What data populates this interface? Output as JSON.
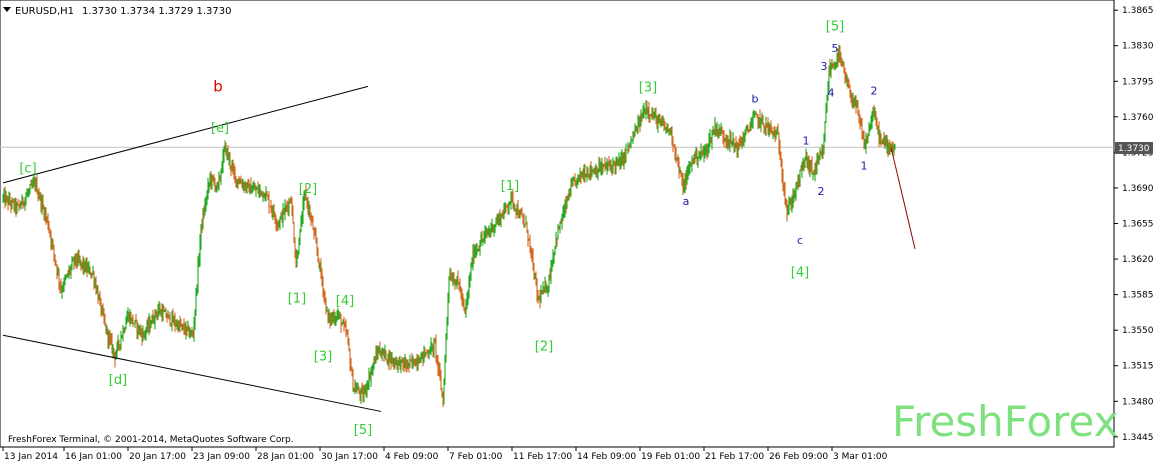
{
  "header": {
    "symbol": "EURUSD,H1",
    "ohlc": "1.3730 1.3734 1.3729 1.3730"
  },
  "current_price": "1.3730",
  "copyright": "FreshForex Terminal, © 2001-2014, MetaQuotes Software Corp.",
  "brand": "FreshForex",
  "colors": {
    "bull": "#22aa22",
    "bear": "#d2691e",
    "wave_green": "#33cc33",
    "wave_blue": "#1a1aa6",
    "wave_red": "#e00000",
    "forecast": "#8b0000",
    "brand": "#7fe07f"
  },
  "chart_data": {
    "type": "line",
    "ylim": [
      1.3435,
      1.3875
    ],
    "y_ticks": [
      "1.3865",
      "1.3830",
      "1.3795",
      "1.3760",
      "1.3725",
      "1.3690",
      "1.3655",
      "1.3620",
      "1.3585",
      "1.3550",
      "1.3515",
      "1.3480",
      "1.3445"
    ],
    "x_ticks": [
      {
        "label": "13 Jan 2014",
        "bar": 0
      },
      {
        "label": "16 Jan 01:00",
        "bar": 61
      },
      {
        "label": "20 Jan 17:00",
        "bar": 125
      },
      {
        "label": "23 Jan 09:00",
        "bar": 189
      },
      {
        "label": "28 Jan 01:00",
        "bar": 253
      },
      {
        "label": "30 Jan 17:00",
        "bar": 317
      },
      {
        "label": "4 Feb 09:00",
        "bar": 381
      },
      {
        "label": "7 Feb 01:00",
        "bar": 445
      },
      {
        "label": "11 Feb 17:00",
        "bar": 509
      },
      {
        "label": "14 Feb 09:00",
        "bar": 573
      },
      {
        "label": "19 Feb 01:00",
        "bar": 637
      },
      {
        "label": "21 Feb 17:00",
        "bar": 701
      },
      {
        "label": "26 Feb 09:00",
        "bar": 765
      },
      {
        "label": "3 Mar 01:00",
        "bar": 829
      }
    ],
    "price_path": [
      [
        0,
        1.368
      ],
      [
        15,
        1.367
      ],
      [
        32,
        1.3695
      ],
      [
        45,
        1.3655
      ],
      [
        58,
        1.359
      ],
      [
        72,
        1.362
      ],
      [
        90,
        1.3605
      ],
      [
        103,
        1.355
      ],
      [
        112,
        1.3525
      ],
      [
        125,
        1.3565
      ],
      [
        140,
        1.3545
      ],
      [
        155,
        1.357
      ],
      [
        175,
        1.3555
      ],
      [
        190,
        1.3545
      ],
      [
        198,
        1.365
      ],
      [
        207,
        1.37
      ],
      [
        215,
        1.369
      ],
      [
        222,
        1.373
      ],
      [
        232,
        1.37
      ],
      [
        245,
        1.369
      ],
      [
        262,
        1.3685
      ],
      [
        275,
        1.3655
      ],
      [
        288,
        1.368
      ],
      [
        293,
        1.3615
      ],
      [
        302,
        1.3685
      ],
      [
        310,
        1.365
      ],
      [
        318,
        1.3605
      ],
      [
        325,
        1.356
      ],
      [
        335,
        1.3565
      ],
      [
        344,
        1.3545
      ],
      [
        350,
        1.3495
      ],
      [
        360,
        1.3485
      ],
      [
        375,
        1.353
      ],
      [
        390,
        1.352
      ],
      [
        405,
        1.3515
      ],
      [
        420,
        1.3525
      ],
      [
        432,
        1.3535
      ],
      [
        440,
        1.348
      ],
      [
        446,
        1.3605
      ],
      [
        456,
        1.3595
      ],
      [
        462,
        1.3565
      ],
      [
        470,
        1.3625
      ],
      [
        480,
        1.364
      ],
      [
        500,
        1.3665
      ],
      [
        508,
        1.368
      ],
      [
        516,
        1.3665
      ],
      [
        524,
        1.365
      ],
      [
        535,
        1.358
      ],
      [
        545,
        1.3595
      ],
      [
        553,
        1.364
      ],
      [
        568,
        1.369
      ],
      [
        580,
        1.3705
      ],
      [
        600,
        1.371
      ],
      [
        618,
        1.3715
      ],
      [
        628,
        1.3735
      ],
      [
        643,
        1.377
      ],
      [
        655,
        1.3755
      ],
      [
        668,
        1.3745
      ],
      [
        680,
        1.369
      ],
      [
        690,
        1.372
      ],
      [
        702,
        1.3725
      ],
      [
        712,
        1.375
      ],
      [
        722,
        1.374
      ],
      [
        735,
        1.373
      ],
      [
        752,
        1.376
      ],
      [
        764,
        1.375
      ],
      [
        775,
        1.374
      ],
      [
        784,
        1.3665
      ],
      [
        795,
        1.3695
      ],
      [
        802,
        1.372
      ],
      [
        810,
        1.3705
      ],
      [
        820,
        1.3725
      ],
      [
        826,
        1.3805
      ],
      [
        836,
        1.382
      ],
      [
        846,
        1.3785
      ],
      [
        853,
        1.377
      ],
      [
        862,
        1.373
      ],
      [
        870,
        1.3765
      ],
      [
        878,
        1.3735
      ],
      [
        892,
        1.373
      ]
    ],
    "forecast": [
      [
        888,
        1.373
      ],
      [
        912,
        1.363
      ]
    ],
    "lines": [
      {
        "from": [
          0,
          1.3695
        ],
        "to": [
          365,
          1.379
        ]
      },
      {
        "from": [
          0,
          1.3545
        ],
        "to": [
          378,
          1.347
        ]
      }
    ],
    "annotations": [
      {
        "text": "[c]",
        "bar": 25,
        "price": 1.3705,
        "style": "green"
      },
      {
        "text": "[d]",
        "bar": 115,
        "price": 1.3497,
        "style": "green"
      },
      {
        "text": "[e]",
        "bar": 217,
        "price": 1.3745,
        "style": "green"
      },
      {
        "text": "b",
        "bar": 215,
        "price": 1.3785,
        "style": "red"
      },
      {
        "text": "[2]",
        "bar": 305,
        "price": 1.3685,
        "style": "green"
      },
      {
        "text": "[1]",
        "bar": 294,
        "price": 1.3577,
        "style": "green"
      },
      {
        "text": "[4]",
        "bar": 342,
        "price": 1.3575,
        "style": "green"
      },
      {
        "text": "[3]",
        "bar": 320,
        "price": 1.352,
        "style": "green"
      },
      {
        "text": "[5]",
        "bar": 360,
        "price": 1.3448,
        "style": "green"
      },
      {
        "text": "[1]",
        "bar": 507,
        "price": 1.3688,
        "style": "green"
      },
      {
        "text": "[2]",
        "bar": 541,
        "price": 1.353,
        "style": "green"
      },
      {
        "text": "[3]",
        "bar": 645,
        "price": 1.3785,
        "style": "green"
      },
      {
        "text": "a",
        "bar": 683,
        "price": 1.3673,
        "style": "blue"
      },
      {
        "text": "b",
        "bar": 752,
        "price": 1.3774,
        "style": "blue"
      },
      {
        "text": "c",
        "bar": 797,
        "price": 1.3635,
        "style": "blue"
      },
      {
        "text": "[4]",
        "bar": 797,
        "price": 1.3603,
        "style": "green"
      },
      {
        "text": "1",
        "bar": 803,
        "price": 1.3733,
        "style": "blue"
      },
      {
        "text": "2",
        "bar": 818,
        "price": 1.3683,
        "style": "blue"
      },
      {
        "text": "3",
        "bar": 821,
        "price": 1.3806,
        "style": "blue"
      },
      {
        "text": "4",
        "bar": 828,
        "price": 1.378,
        "style": "blue"
      },
      {
        "text": "5",
        "bar": 832,
        "price": 1.3824,
        "style": "blue"
      },
      {
        "text": "[5]",
        "bar": 832,
        "price": 1.3845,
        "style": "green"
      },
      {
        "text": "2",
        "bar": 871,
        "price": 1.3782,
        "style": "blue"
      },
      {
        "text": "1",
        "bar": 861,
        "price": 1.3708,
        "style": "blue"
      }
    ]
  }
}
